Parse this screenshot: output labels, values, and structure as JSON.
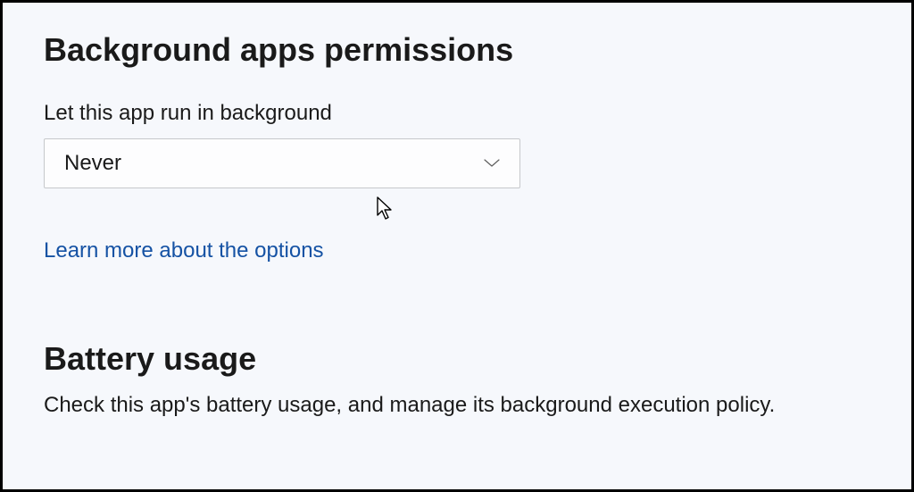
{
  "background_apps": {
    "heading": "Background apps permissions",
    "label": "Let this app run in background",
    "dropdown_value": "Never",
    "learn_more_link": "Learn more about the options"
  },
  "battery_usage": {
    "heading": "Battery usage",
    "description": "Check this app's battery usage, and manage its background execution policy."
  }
}
